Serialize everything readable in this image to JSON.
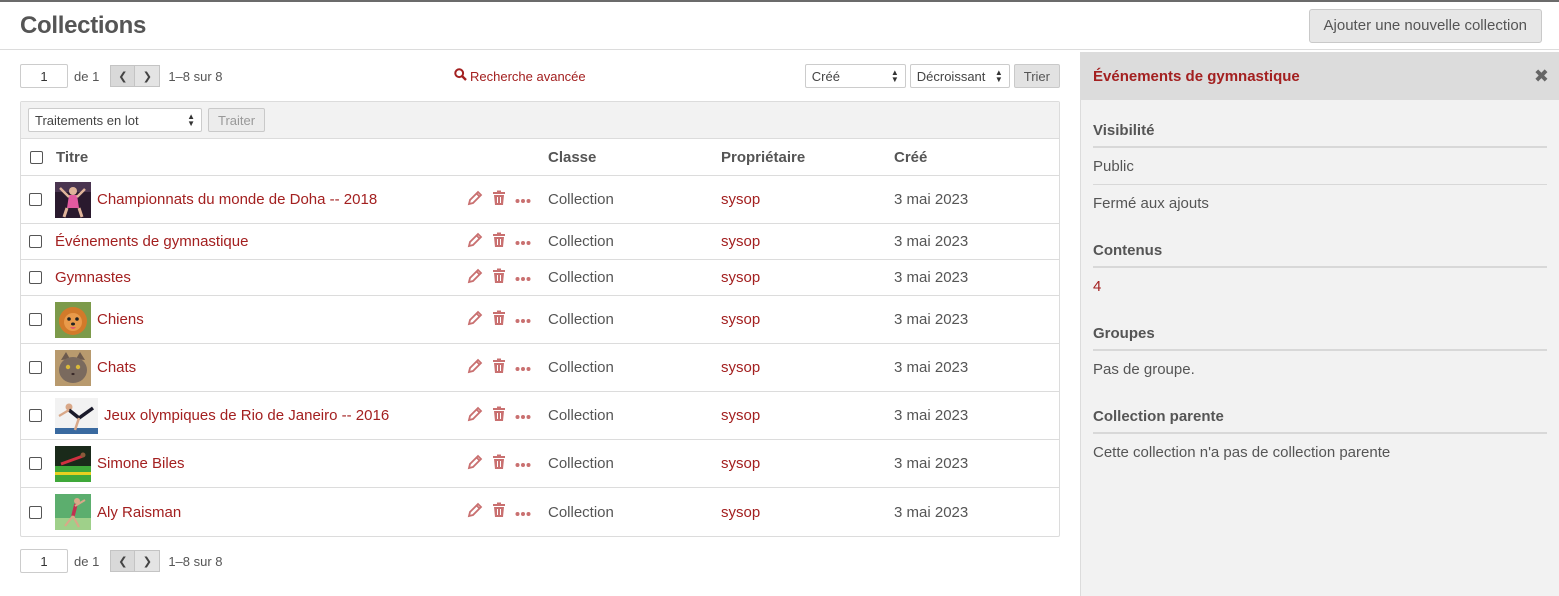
{
  "header": {
    "title": "Collections",
    "add_button": "Ajouter une nouvelle collection"
  },
  "pager": {
    "page": "1",
    "of_label": "de 1",
    "count": "1–8 sur 8"
  },
  "search": {
    "advanced_label": "Recherche avancée"
  },
  "sort": {
    "field": "Créé",
    "direction": "Décroissant",
    "button": "Trier"
  },
  "batch": {
    "select": "Traitements en lot",
    "button": "Traiter"
  },
  "table": {
    "columns": {
      "title": "Titre",
      "class": "Classe",
      "owner": "Propriétaire",
      "created": "Créé"
    },
    "rows": [
      {
        "title": "Championnats du monde de Doha -- 2018",
        "class": "Collection",
        "owner": "sysop",
        "created": "3 mai 2023",
        "thumb": "gymnast-pink"
      },
      {
        "title": "Événements de gymnastique",
        "class": "Collection",
        "owner": "sysop",
        "created": "3 mai 2023",
        "thumb": ""
      },
      {
        "title": "Gymnastes",
        "class": "Collection",
        "owner": "sysop",
        "created": "3 mai 2023",
        "thumb": ""
      },
      {
        "title": "Chiens",
        "class": "Collection",
        "owner": "sysop",
        "created": "3 mai 2023",
        "thumb": "dog"
      },
      {
        "title": "Chats",
        "class": "Collection",
        "owner": "sysop",
        "created": "3 mai 2023",
        "thumb": "cat"
      },
      {
        "title": "Jeux olympiques de Rio de Janeiro -- 2016",
        "class": "Collection",
        "owner": "sysop",
        "created": "3 mai 2023",
        "thumb": "gymnast-white"
      },
      {
        "title": "Simone Biles",
        "class": "Collection",
        "owner": "sysop",
        "created": "3 mai 2023",
        "thumb": "gymnast-green"
      },
      {
        "title": "Aly Raisman",
        "class": "Collection",
        "owner": "sysop",
        "created": "3 mai 2023",
        "thumb": "gymnast-field"
      }
    ]
  },
  "sidebar": {
    "title": "Événements de gymnastique",
    "visibility_label": "Visibilité",
    "visibility_value": "Public",
    "adds_value": "Fermé aux ajouts",
    "contents_label": "Contenus",
    "contents_value": "4",
    "groups_label": "Groupes",
    "groups_value": "Pas de groupe.",
    "parent_label": "Collection parente",
    "parent_value": "Cette collection n'a pas de collection parente"
  },
  "colors": {
    "accent": "#a32020",
    "panel": "#f2f2f2",
    "border": "#dcdcdc"
  }
}
